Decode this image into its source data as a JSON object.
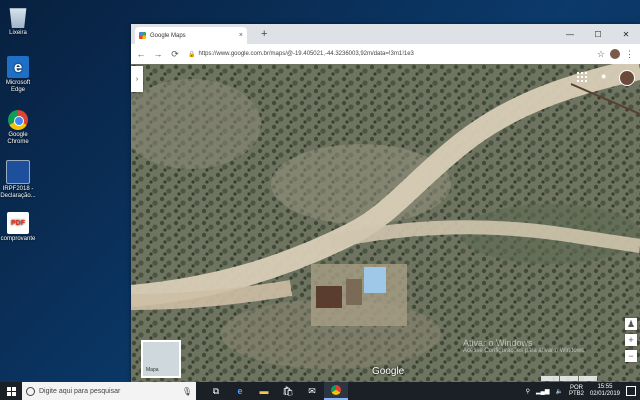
{
  "desktop": {
    "icons": [
      {
        "name": "recycle-bin",
        "label": "Lixeira"
      },
      {
        "name": "microsoft-edge",
        "label": "Microsoft Edge"
      },
      {
        "name": "google-chrome",
        "label": "Google Chrome"
      },
      {
        "name": "irpf-2018",
        "label": "IRPF2018 - Declaração..."
      },
      {
        "name": "comprovante",
        "label": "comprovante",
        "badge": "PDF"
      }
    ]
  },
  "browser": {
    "tab_title": "Google Maps",
    "tab_close": "×",
    "new_tab": "+",
    "window_controls": {
      "minimize": "—",
      "maximize": "☐",
      "close": "✕"
    },
    "nav": {
      "back": "←",
      "forward": "→",
      "reload": "⟳"
    },
    "url": "https://www.google.com.br/maps/@-19.405021,-44.3236003,92m/data=!3m1!1e3",
    "bookmark": "☆",
    "menu": "⋮"
  },
  "map": {
    "sidebar_toggle": "›",
    "layer_label": "Mapa",
    "google_logo": "Google",
    "watermark_title": "Ativar o Windows",
    "watermark_sub": "Acesse Configurações para ativar o Windows.",
    "zoom_in": "+",
    "zoom_out": "−",
    "pegman": "♟",
    "colors": {
      "terrain": "#6f7461",
      "road": "#d8cdb6",
      "roof_blue": "#9ec7e8"
    }
  },
  "taskbar": {
    "search_placeholder": "Digite aqui para pesquisar",
    "mic": "🎤",
    "apps": [
      "task-view",
      "edge",
      "file-explorer",
      "store",
      "mail",
      "chrome"
    ],
    "tray": {
      "language_top": "POR",
      "language_bottom": "PTB2",
      "time": "15:55",
      "date": "02/01/2019"
    }
  }
}
